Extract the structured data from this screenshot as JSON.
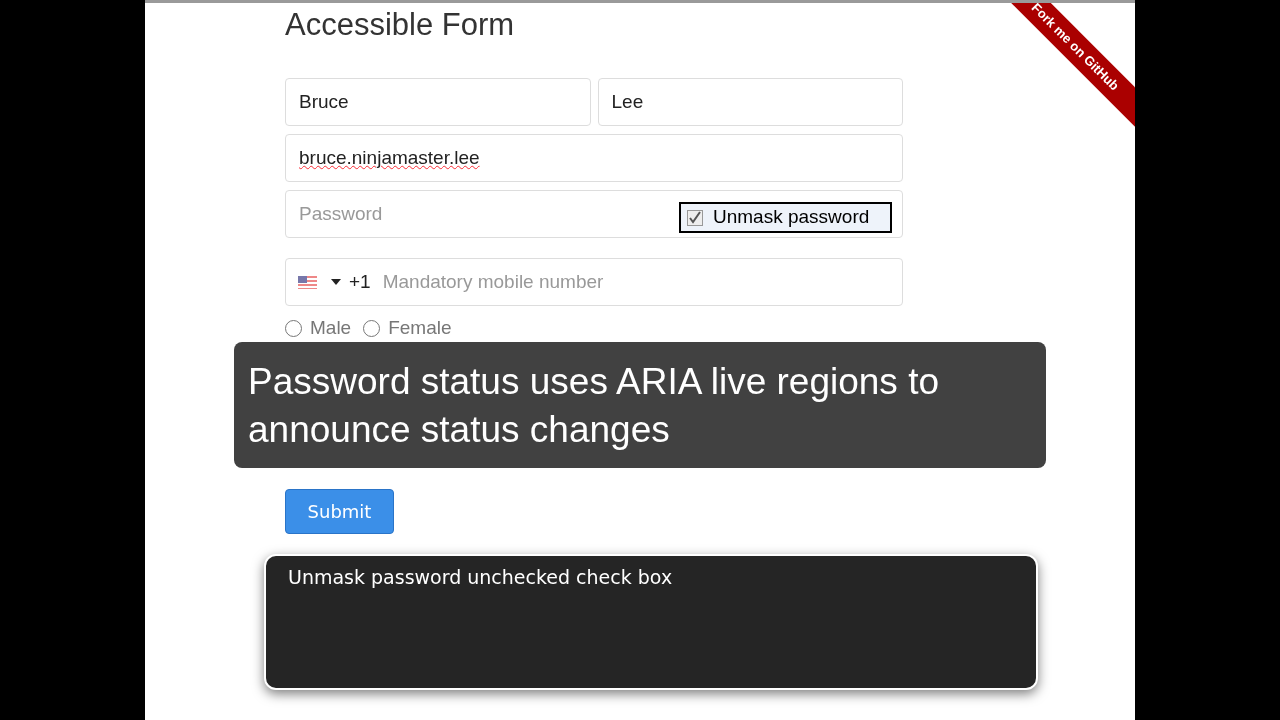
{
  "ribbon": {
    "label": "Fork me on GitHub"
  },
  "form": {
    "title": "Accessible Form",
    "first_name": {
      "value": "Bruce"
    },
    "last_name": {
      "value": "Lee"
    },
    "username": {
      "value": "bruce.ninjamaster.lee"
    },
    "password": {
      "placeholder": "Password"
    },
    "unmask": {
      "label": "Unmask password",
      "checked": true
    },
    "phone": {
      "code": "+1",
      "placeholder": "Mandatory mobile number"
    },
    "gender": [
      {
        "label": "Male",
        "selected": false
      },
      {
        "label": "Female",
        "selected": false
      }
    ],
    "submit": "Submit"
  },
  "caption": {
    "text": "Password status uses ARIA live regions to announce status changes"
  },
  "screen_reader": {
    "text": "Unmask password unchecked check box"
  }
}
